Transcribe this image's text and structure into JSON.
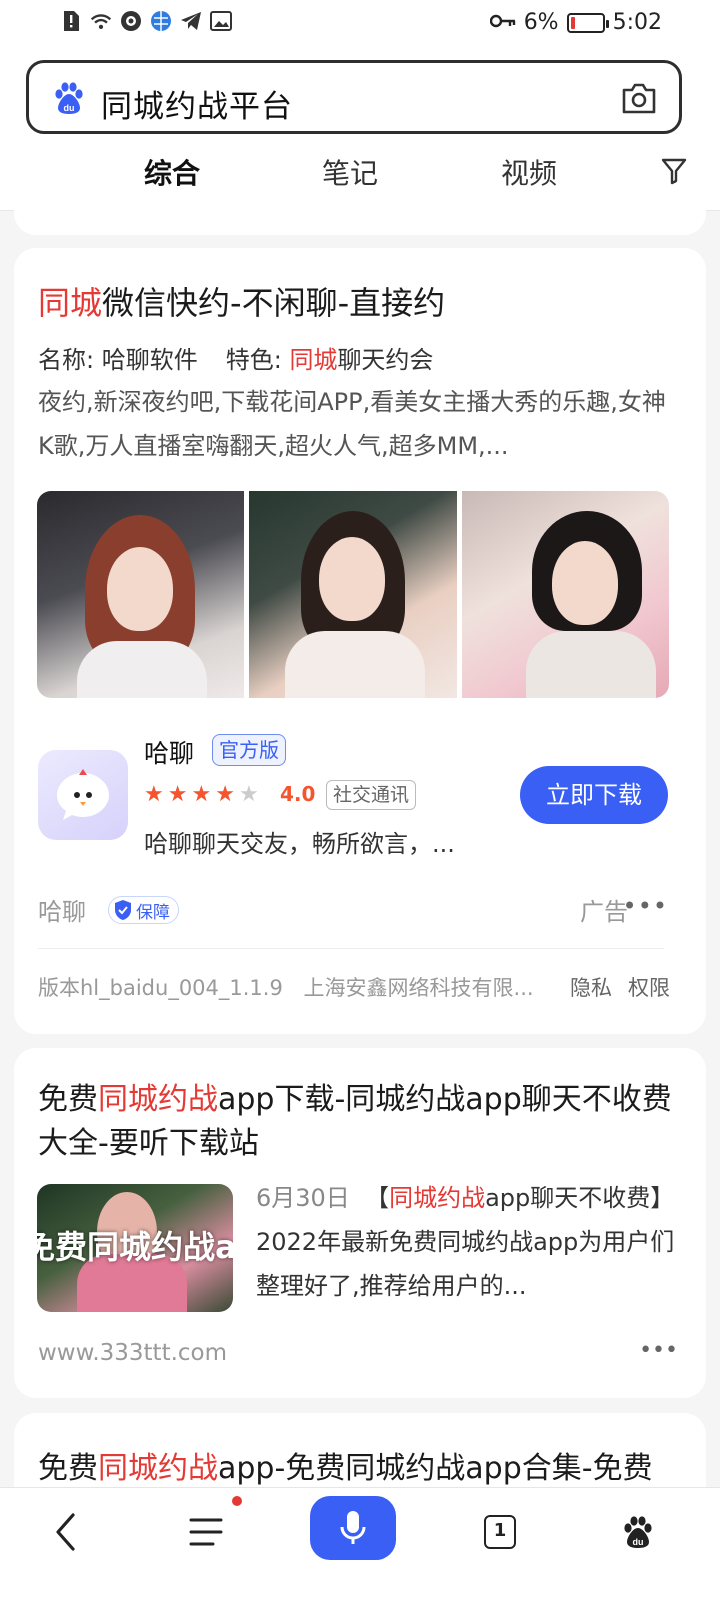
{
  "status_bar": {
    "battery": "6%",
    "time": "5:02"
  },
  "search": {
    "query": "同城约战平台"
  },
  "tabs": [
    {
      "label": "综合"
    },
    {
      "label": "笔记"
    },
    {
      "label": "视频"
    }
  ],
  "ad_card": {
    "title_hl": "同城",
    "title_rest": "微信快约-不闲聊-直接约",
    "meta_name": "名称: 哈聊软件",
    "meta_feature_label": "特色: ",
    "meta_feature_hl": "同城",
    "meta_feature_rest": "聊天约会",
    "desc": "夜约,新深夜约吧,下载花间APP,看美女主播大秀的乐趣,女神K歌,万人直播室嗨翻天,超火人气,超多MM,...",
    "app_name": "哈聊",
    "official_badge": "官方版",
    "rating": "4.0",
    "rating_value": 4,
    "category": "社交通讯",
    "app_desc": "哈聊聊天交友，畅所欲言，...",
    "download_label": "立即下载",
    "source_name": "哈聊",
    "guarantee_label": "保障",
    "ad_label": "广告",
    "more": "•••",
    "version": "版本hl_baidu_004_1.1.9",
    "developer": "上海安鑫网络科技有限...",
    "privacy": "隐私",
    "permission": "权限"
  },
  "result2": {
    "title_a": "免费",
    "title_hl": "同城约战",
    "title_b": "app下载-同城约战app聊天不收费大全-要听下载站",
    "thumb_text": "免费同城约战a",
    "date": "6月30日",
    "snippet_a": "【",
    "snippet_hl": "同城约战",
    "snippet_b": "app聊天不收费】2022年最新免费同城约战app为用户们整理好了,推荐给用户的...",
    "url": "www.333ttt.com",
    "more": "•••"
  },
  "result3": {
    "title_a": "免费",
    "title_hl": "同城约战",
    "title_b": "app-免费同城约战app合集-免费"
  },
  "bottom_nav": {
    "tab_count": "1"
  },
  "colors": {
    "accent": "#3a5ff5",
    "highlight": "#e53935",
    "star": "#f4542e"
  }
}
